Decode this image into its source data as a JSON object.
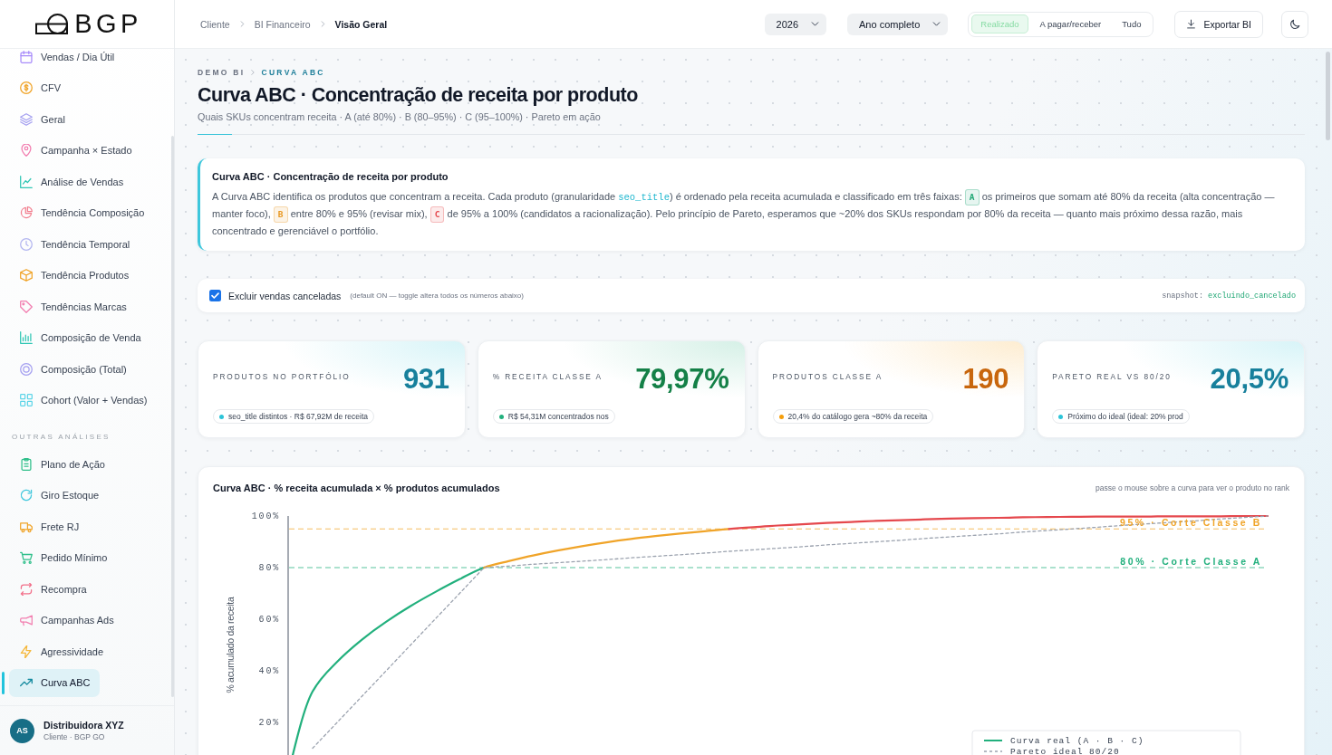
{
  "sidebar": {
    "logo": {
      "text": "BGP"
    },
    "sections": [
      {
        "items": [
          {
            "label": "Vendas / Dia Útil",
            "selected": false
          },
          {
            "label": "CFV",
            "selected": false
          },
          {
            "label": "Geral",
            "selected": false
          },
          {
            "label": "Campanha × Estado",
            "selected": false
          },
          {
            "label": "Análise de Vendas",
            "selected": false
          },
          {
            "label": "Tendência Composição",
            "selected": false
          },
          {
            "label": "Tendência Temporal",
            "selected": false
          },
          {
            "label": "Tendência Produtos",
            "selected": false
          },
          {
            "label": "Tendências Marcas",
            "selected": false
          },
          {
            "label": "Composição de Venda",
            "selected": false
          },
          {
            "label": "Composição (Total)",
            "selected": false
          },
          {
            "label": "Cohort (Valor + Vendas)",
            "selected": false
          }
        ]
      },
      {
        "title": "OUTRAS ANÁLISES",
        "items": [
          {
            "label": "Plano de Ação",
            "selected": false
          },
          {
            "label": "Giro Estoque",
            "selected": false
          },
          {
            "label": "Frete RJ",
            "selected": false
          },
          {
            "label": "Pedido Mínimo",
            "selected": false
          },
          {
            "label": "Recompra",
            "selected": false
          },
          {
            "label": "Campanhas Ads",
            "selected": false
          },
          {
            "label": "Agressividade",
            "selected": false
          },
          {
            "label": "Curva ABC",
            "selected": true
          }
        ]
      }
    ],
    "account": {
      "initials": "AS",
      "name": "Distribuidora XYZ",
      "subtitle": "Cliente · BGP GO"
    }
  },
  "topbar": {
    "breadcrumb": [
      "Cliente",
      "BI Financeiro",
      "Visão Geral"
    ],
    "year_select": "2026",
    "period_select": "Ano completo",
    "view_tabs": [
      {
        "label": "Realizado",
        "selected": true
      },
      {
        "label": "A pagar/receber",
        "selected": false
      },
      {
        "label": "Tudo",
        "selected": false
      }
    ],
    "export_button": "Exportar BI"
  },
  "page_header": {
    "eyebrow": [
      "DEMO BI",
      "CURVA ABC"
    ],
    "title": "Curva ABC · Concentração de receita por produto",
    "subtitle": "Quais SKUs concentram receita · A (até 80%) · B (80–95%) · C (95–100%) · Pareto em ação"
  },
  "info_card": {
    "title": "Curva ABC · Concentração de receita por produto",
    "segments": [
      {
        "kind": "text",
        "text": "A Curva ABC identifica os produtos que concentram a receita. Cada produto (granularidade "
      },
      {
        "kind": "code",
        "text": "seo_title"
      },
      {
        "kind": "text",
        "text": ") é ordenado pela receita acumulada e classificado em três faixas: "
      },
      {
        "kind": "badge",
        "text": "A",
        "color": "#1fa774"
      },
      {
        "kind": "text",
        "text": " os primeiros que somam até 80% da receita (alta concentração — manter foco), "
      },
      {
        "kind": "badge",
        "text": "B",
        "color": "#e8961e"
      },
      {
        "kind": "text",
        "text": " entre 80% e 95% (revisar mix), "
      },
      {
        "kind": "badge",
        "text": "C",
        "color": "#e5484d"
      },
      {
        "kind": "text",
        "text": " de 95% a 100% (candidatos a racionalização). Pelo princípio de Pareto, esperamos que ~20% dos SKUs respondam por 80% da receita — quanto mais próximo dessa razão, mais concentrado e gerenciável o portfólio."
      }
    ]
  },
  "toggle_bar": {
    "checkbox": {
      "label": "Excluir vendas canceladas",
      "checked": true
    },
    "hint": "(default ON — toggle altera todos os números abaixo)",
    "snapshot_key": "snapshot:",
    "snapshot_value": "excluindo_cancelado"
  },
  "kpis": [
    {
      "label": "PRODUTOS NO PORTFÓLIO",
      "value": {
        "text": "931",
        "color": "#17809c"
      },
      "note": {
        "text": "seo_title distintos · R$ 67,92M de receita",
        "color": "#2cc4d8"
      }
    },
    {
      "label": "% RECEITA CLASSE A",
      "value": {
        "text": "79,97%",
        "color": "#148047"
      },
      "note": {
        "text": "R$ 54,31M concentrados nos",
        "color": "#22b07d"
      }
    },
    {
      "label": "PRODUTOS CLASSE A",
      "value": {
        "text": "190",
        "color": "#c8660c"
      },
      "note": {
        "text": "20,4% do catálogo gera ~80% da receita",
        "color": "#f59e0b"
      }
    },
    {
      "label": "PARETO REAL VS 80/20",
      "value": {
        "text": "20,5%",
        "color": "#17809c"
      },
      "note": {
        "text": "Próximo do ideal (ideal: 20% prod",
        "color": "#2cc4d8"
      }
    }
  ],
  "chart": {
    "title": "Curva ABC · % receita acumulada × % produtos acumulados",
    "hint": "passe o mouse sobre a curva para ver o produto no rank",
    "chart_data": {
      "type": "line",
      "ylabel": "% acumulado da receita",
      "categories": [
        null,
        null,
        null,
        null,
        null,
        null,
        null,
        null,
        null,
        null,
        null,
        null,
        null,
        null,
        null,
        null,
        null,
        null,
        null,
        null,
        null,
        null,
        null,
        null,
        null,
        null,
        null,
        null,
        null,
        null,
        null,
        null,
        null,
        null,
        null,
        null,
        null,
        null,
        null,
        null,
        null
      ],
      "series": [
        {
          "name": "Curva real (A · B · C)",
          "color": "#22b07d",
          "line_style": "solid",
          "values": [
            0,
            32,
            43.5,
            52,
            59,
            65.1,
            70.5,
            75.5,
            80,
            null,
            null,
            null,
            null,
            null,
            null,
            null,
            null,
            null,
            null,
            null,
            null,
            null,
            null,
            null,
            null,
            null,
            null,
            null,
            null,
            null,
            null,
            null,
            null,
            null,
            null,
            null,
            null,
            null,
            null,
            null,
            null
          ]
        },
        {
          "color": "#f0a429",
          "line_style": "solid",
          "values": [
            null,
            null,
            null,
            null,
            null,
            null,
            null,
            null,
            80,
            82.5,
            84.7,
            86.6,
            88.3,
            89.8,
            91.1,
            92.2,
            93.2,
            94.1,
            95,
            null,
            null,
            null,
            null,
            null,
            null,
            null,
            null,
            null,
            null,
            null,
            null,
            null,
            null,
            null,
            null,
            null,
            null,
            null,
            null,
            null,
            null
          ]
        },
        {
          "color": "#e5484d",
          "line_style": "solid",
          "values": [
            null,
            null,
            null,
            null,
            null,
            null,
            null,
            null,
            null,
            null,
            null,
            null,
            null,
            null,
            null,
            null,
            null,
            null,
            95,
            95.7,
            96.3,
            96.8,
            97.3,
            97.7,
            98.1,
            98.4,
            98.7,
            99,
            99.2,
            99.3,
            99.5,
            99.6,
            99.7,
            99.8,
            99.8,
            99.8,
            99.9,
            99.9,
            99.9,
            100,
            100
          ]
        },
        {
          "name": "Pareto ideal 80/20",
          "color": "#9ca3af",
          "line_style": "dashed",
          "values": [
            null,
            10,
            20,
            30,
            40,
            50,
            60,
            70,
            80,
            80.6,
            81.3,
            81.9,
            82.5,
            83.1,
            83.8,
            84.4,
            85,
            85.6,
            86.3,
            86.9,
            87.5,
            88.1,
            88.8,
            89.4,
            90,
            90.6,
            91.3,
            91.9,
            92.5,
            93.1,
            93.8,
            94.4,
            95,
            95.6,
            96.3,
            96.9,
            97.5,
            98.1,
            98.8,
            99.4,
            100
          ]
        }
      ],
      "ylim": [
        0,
        100
      ],
      "yticks": [
        {
          "value": 20,
          "label": "20%"
        },
        {
          "value": 40,
          "label": "40%"
        },
        {
          "value": 60,
          "label": "60%"
        },
        {
          "value": 80,
          "label": "80%"
        },
        {
          "value": 100,
          "label": "100%"
        }
      ],
      "ref_lines": [
        {
          "axis": "y",
          "value": 95,
          "label": "95% · Corte Classe B",
          "color": "#f0a429"
        },
        {
          "axis": "y",
          "value": 80,
          "label": "80% · Corte Classe A",
          "color": "#22b07d"
        }
      ],
      "legend": "lower right"
    }
  }
}
